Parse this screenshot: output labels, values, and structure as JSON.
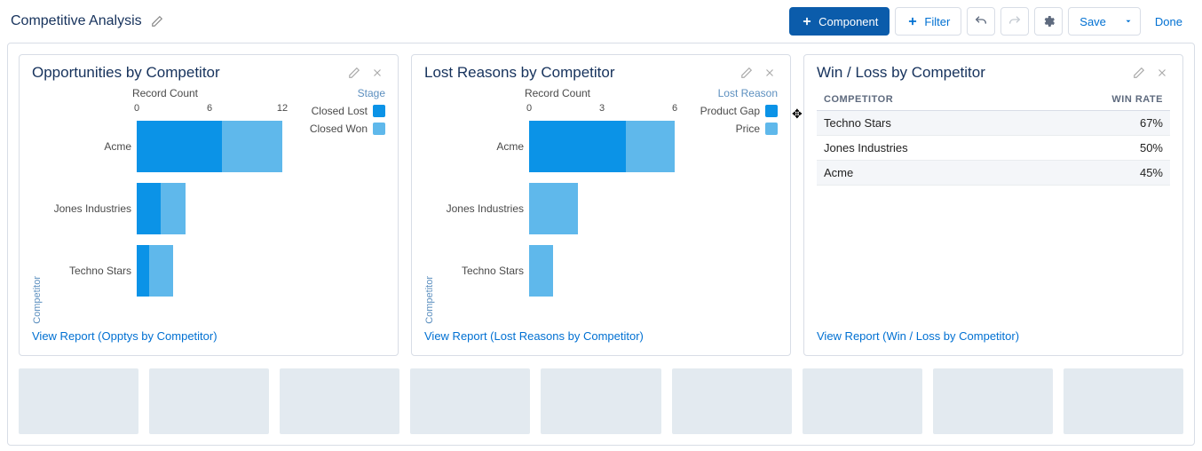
{
  "page": {
    "title": "Competitive Analysis"
  },
  "toolbar": {
    "component": "Component",
    "filter": "Filter",
    "save": "Save",
    "done": "Done"
  },
  "cards": [
    {
      "title": "Opportunities by Competitor",
      "footer": "View Report (Opptys by Competitor)"
    },
    {
      "title": "Lost Reasons by Competitor",
      "footer": "View Report (Lost Reasons by Competitor)"
    },
    {
      "title": "Win / Loss by Competitor",
      "footer": "View Report (Win / Loss by Competitor)"
    }
  ],
  "table": {
    "headers": [
      "COMPETITOR",
      "WIN RATE"
    ],
    "rows": [
      {
        "competitor": "Techno Stars",
        "winrate": "67%"
      },
      {
        "competitor": "Jones Industries",
        "winrate": "50%"
      },
      {
        "competitor": "Acme",
        "winrate": "45%"
      }
    ]
  },
  "chart_data": [
    {
      "type": "bar",
      "orientation": "horizontal",
      "title": "Opportunities by Competitor",
      "xlabel": "Record Count",
      "ylabel": "Competitor",
      "xlim": [
        0,
        12
      ],
      "xticks": [
        0,
        6,
        12
      ],
      "categories": [
        "Acme",
        "Jones Industries",
        "Techno Stars"
      ],
      "legend_title": "Stage",
      "series": [
        {
          "name": "Closed Lost",
          "color": "#0b93e7",
          "values": [
            7,
            2,
            1
          ]
        },
        {
          "name": "Closed Won",
          "color": "#5fb8eb",
          "values": [
            5,
            2,
            2
          ]
        }
      ]
    },
    {
      "type": "bar",
      "orientation": "horizontal",
      "title": "Lost Reasons by Competitor",
      "xlabel": "Record Count",
      "ylabel": "Competitor",
      "xlim": [
        0,
        6
      ],
      "xticks": [
        0,
        3,
        6
      ],
      "categories": [
        "Acme",
        "Jones Industries",
        "Techno Stars"
      ],
      "legend_title": "Lost Reason",
      "series": [
        {
          "name": "Product Gap",
          "color": "#0b93e7",
          "values": [
            4,
            0,
            0
          ]
        },
        {
          "name": "Price",
          "color": "#5fb8eb",
          "values": [
            2,
            2,
            1
          ]
        }
      ]
    }
  ],
  "colors": {
    "primary": "#0b5cab",
    "link": "#0070d2"
  }
}
